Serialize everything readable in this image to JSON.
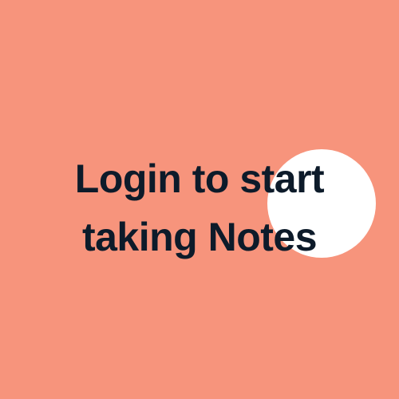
{
  "colors": {
    "background": "#F7947C",
    "circle": "#FFFFFF",
    "text": "#0D1B2A"
  },
  "headline": {
    "line1": "Login to start",
    "line2": "taking Notes"
  }
}
